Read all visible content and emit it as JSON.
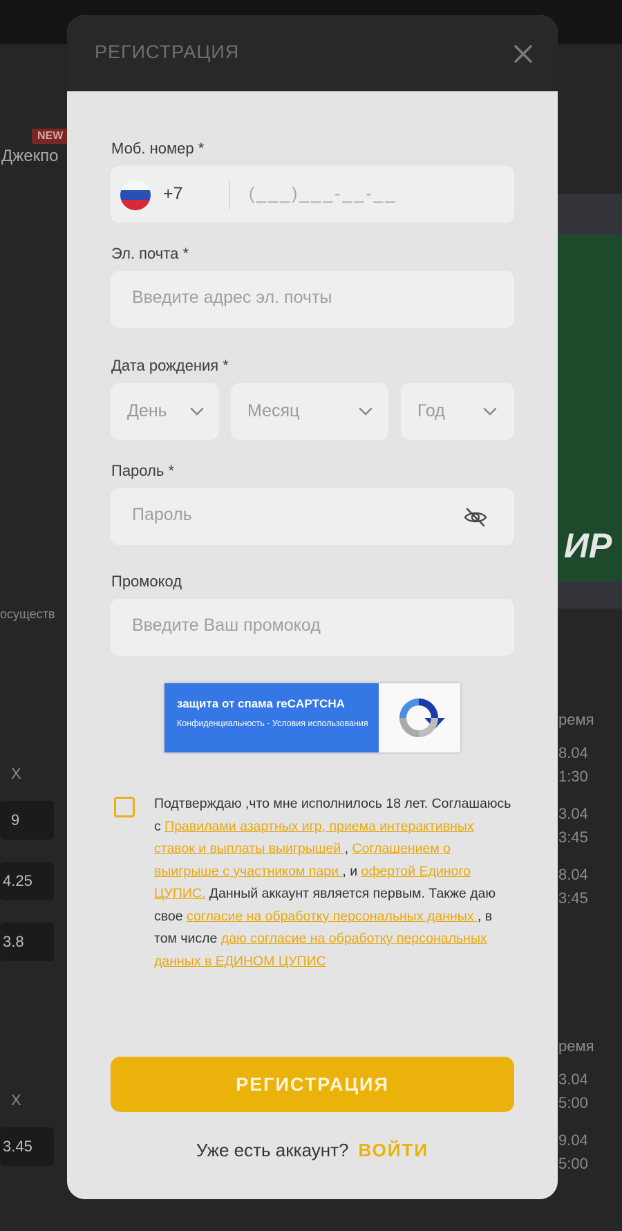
{
  "background": {
    "badge_new": "NEW",
    "jackpot_label": "Джекпо",
    "banner_text": "ИР",
    "side_text_1": "осуществ",
    "col_x_1": "X",
    "col_x_2": "X",
    "cells": [
      "9",
      "4.25",
      "3.8",
      "3.45"
    ],
    "time_header_1": "ремя",
    "time_header_2": "ремя",
    "times": [
      "8.04",
      "1:30",
      "3.04",
      "3:45",
      "8.04",
      "3:45",
      "3.04",
      "5:00",
      "9.04",
      "5:00"
    ]
  },
  "modal": {
    "title": "РЕГИСТРАЦИЯ",
    "phone": {
      "label": "Моб. номер *",
      "country_code": "+7",
      "mask": "(___)___-__-__"
    },
    "email": {
      "label": "Эл. почта *",
      "placeholder": "Введите адрес эл. почты"
    },
    "birthdate": {
      "label": "Дата рождения *",
      "day": "День",
      "month": "Месяц",
      "year": "Год"
    },
    "password": {
      "label": "Пароль *",
      "placeholder": "Пароль"
    },
    "promo": {
      "label": "Промокод",
      "placeholder": "Введите Ваш промокод"
    },
    "recaptcha": {
      "title": "защита от спама reCAPTCHA",
      "privacy": "Конфиденциальность",
      "separator": " - ",
      "terms": "Условия использования"
    },
    "terms": {
      "line1": "Подтверждаю ,что мне исполнилось 18 лет. Соглашаюсь с ",
      "link1": "Правилами азартных игр, приема интерактивных ставок и выплаты выигрышей ",
      "sep1": ", ",
      "link2": "Соглашением о выигрыше с участником пари ",
      "sep2": ", и ",
      "link3": "офертой Единого ЦУПИС.",
      "text2": " Данный аккаунт является первым. Также даю свое ",
      "link4": "согласие на обработку персональных данных ",
      "text3": ", в том числе ",
      "link5": "даю согласие на обработку персональных данных в ЕДИНОМ  ЦУПИС"
    },
    "submit_label": "РЕГИСТРАЦИЯ",
    "login_question": "Уже есть аккаунт?",
    "login_link": "ВОЙТИ"
  }
}
